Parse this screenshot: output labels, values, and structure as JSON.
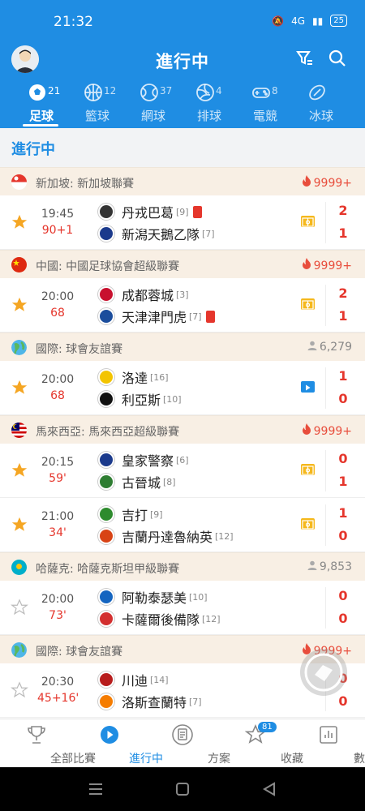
{
  "status": {
    "time": "21:32",
    "battery": "25",
    "signal": "4G"
  },
  "header": {
    "title": "進行中"
  },
  "sport_tabs": [
    {
      "label": "足球",
      "count": "21",
      "active": true
    },
    {
      "label": "籃球",
      "count": "12"
    },
    {
      "label": "網球",
      "count": "37"
    },
    {
      "label": "排球",
      "count": "4"
    },
    {
      "label": "電競",
      "count": "8"
    },
    {
      "label": "冰球",
      "count": ""
    }
  ],
  "section_title": "進行中",
  "leagues": [
    {
      "name": "新加坡: 新加坡聯賽",
      "heat": "9999+",
      "heat_type": "fire",
      "flag": "singapore",
      "matches": [
        {
          "time": "19:45",
          "minute": "90+1",
          "starred": true,
          "home": "丹戎巴葛",
          "home_rank": "[9]",
          "home_red": true,
          "away": "新潟天鵝乙隊",
          "away_rank": "[7]",
          "away_red": false,
          "home_score": "2",
          "away_score": "1",
          "mark": "field"
        }
      ]
    },
    {
      "name": "中國: 中國足球協會超級聯賽",
      "heat": "9999+",
      "heat_type": "fire",
      "flag": "china",
      "matches": [
        {
          "time": "20:00",
          "minute": "68",
          "starred": true,
          "home": "成都蓉城",
          "home_rank": "[3]",
          "home_red": false,
          "away": "天津津門虎",
          "away_rank": "[7]",
          "away_red": true,
          "home_score": "2",
          "away_score": "1",
          "mark": "field"
        }
      ]
    },
    {
      "name": "國際: 球會友誼賽",
      "heat": "6,279",
      "heat_type": "people",
      "flag": "world",
      "matches": [
        {
          "time": "20:00",
          "minute": "68",
          "starred": true,
          "home": "洛達",
          "home_rank": "[16]",
          "home_red": false,
          "away": "利亞斯",
          "away_rank": "[10]",
          "away_red": false,
          "home_score": "1",
          "away_score": "0",
          "mark": "video"
        }
      ]
    },
    {
      "name": "馬來西亞: 馬來西亞超級聯賽",
      "heat": "9999+",
      "heat_type": "fire",
      "flag": "malaysia",
      "matches": [
        {
          "time": "20:15",
          "minute": "59'",
          "starred": true,
          "home": "皇家警察",
          "home_rank": "[6]",
          "home_red": false,
          "away": "古晉城",
          "away_rank": "[8]",
          "away_red": false,
          "home_score": "0",
          "away_score": "1",
          "mark": "field"
        },
        {
          "time": "21:00",
          "minute": "34'",
          "starred": true,
          "home": "吉打",
          "home_rank": "[9]",
          "home_red": false,
          "away": "吉蘭丹達魯納英",
          "away_rank": "[12]",
          "away_red": false,
          "home_score": "1",
          "away_score": "0",
          "mark": "field"
        }
      ]
    },
    {
      "name": "哈薩克: 哈薩克斯坦甲級聯賽",
      "heat": "9,853",
      "heat_type": "people",
      "flag": "kazakhstan",
      "matches": [
        {
          "time": "20:00",
          "minute": "73'",
          "starred": false,
          "home": "阿勒泰瑟美",
          "home_rank": "[10]",
          "home_red": false,
          "away": "卡薩爾後備隊",
          "away_rank": "[12]",
          "away_red": false,
          "home_score": "0",
          "away_score": "0",
          "mark": ""
        }
      ]
    },
    {
      "name": "國際: 球會友誼賽",
      "heat": "9999+",
      "heat_type": "fire",
      "flag": "world",
      "matches": [
        {
          "time": "20:30",
          "minute": "45+16'",
          "starred": false,
          "home": "川迪",
          "home_rank": "[14]",
          "home_red": false,
          "away": "洛斯查蘭特",
          "away_rank": "[7]",
          "away_red": false,
          "home_score": "0",
          "away_score": "0",
          "mark": ""
        }
      ]
    }
  ],
  "bottom_nav": [
    {
      "label": "全部比賽",
      "icon": "trophy-icon"
    },
    {
      "label": "進行中",
      "icon": "play-icon",
      "active": true
    },
    {
      "label": "方案",
      "icon": "document-icon"
    },
    {
      "label": "收藏",
      "icon": "star-icon",
      "badge": "81"
    },
    {
      "label": "數據",
      "icon": "chart-icon"
    }
  ],
  "colors": {
    "primary": "#1f8de3",
    "live_red": "#e5362c",
    "star": "#f5a623",
    "league_bg": "#f8efe4"
  }
}
